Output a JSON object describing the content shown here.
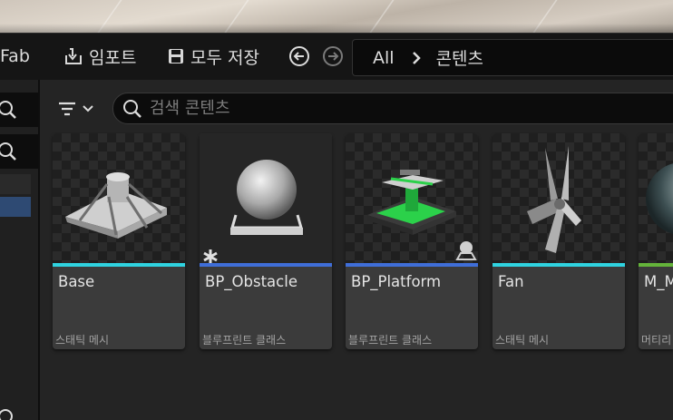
{
  "toolbar": {
    "fab_label": "Fab",
    "import_label": "임포트",
    "save_all_label": "모두 저장",
    "import_icon": "import-icon",
    "save_icon": "save-icon"
  },
  "path": {
    "root": "All",
    "current": "콘텐츠"
  },
  "search": {
    "placeholder": "검색 콘텐츠"
  },
  "colors": {
    "static_mesh": "#2fd3e0",
    "blueprint_class": "#3f6ed8",
    "material": "#64b33a",
    "selection": "#2e4a73"
  },
  "assets": [
    {
      "name": "Base",
      "type": "스태틱 메시"
    },
    {
      "name": "BP_Obstacle",
      "type": "블루프린트 클래스"
    },
    {
      "name": "BP_Platform",
      "type": "블루프린트 클래스"
    },
    {
      "name": "Fan",
      "type": "스태틱 메시"
    },
    {
      "name": "M_M",
      "type": "머티리"
    }
  ]
}
